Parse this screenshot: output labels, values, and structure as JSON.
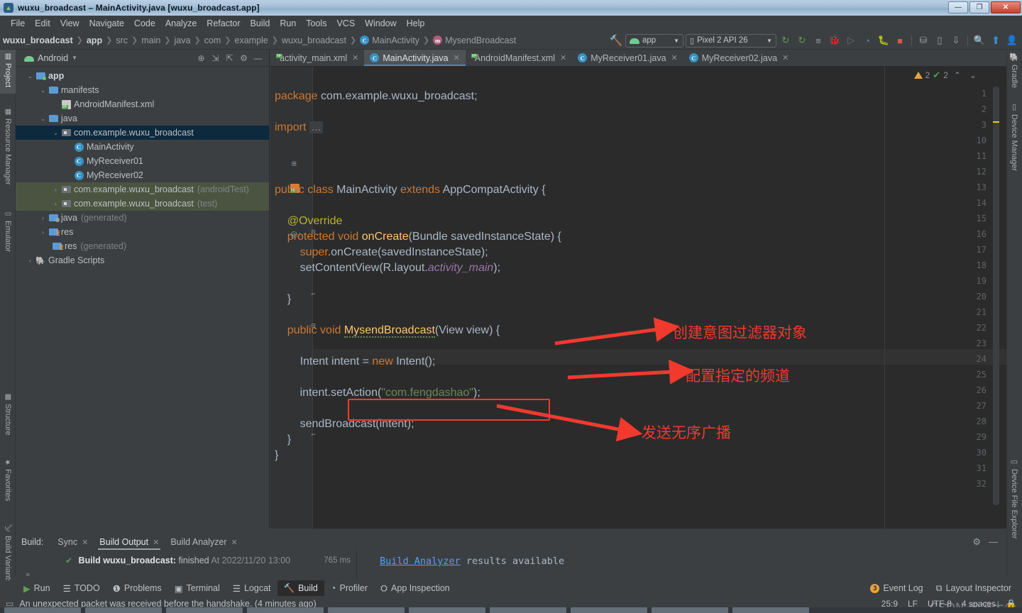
{
  "window": {
    "title": "wuxu_broadcast – MainActivity.java [wuxu_broadcast.app]",
    "minimize_label": "—",
    "maximize_label": "❐",
    "close_label": "✕"
  },
  "menubar": {
    "items": [
      "File",
      "Edit",
      "View",
      "Navigate",
      "Code",
      "Analyze",
      "Refactor",
      "Build",
      "Run",
      "Tools",
      "VCS",
      "Window",
      "Help"
    ]
  },
  "navbar": {
    "breadcrumbs": [
      {
        "label": "wuxu_broadcast",
        "bold": true,
        "icon": ""
      },
      {
        "label": "app",
        "bold": true,
        "icon": ""
      },
      {
        "label": "src",
        "bold": false,
        "icon": ""
      },
      {
        "label": "main",
        "bold": false,
        "icon": ""
      },
      {
        "label": "java",
        "bold": false,
        "icon": ""
      },
      {
        "label": "com",
        "bold": false,
        "icon": ""
      },
      {
        "label": "example",
        "bold": false,
        "icon": ""
      },
      {
        "label": "wuxu_broadcast",
        "bold": false,
        "icon": ""
      },
      {
        "label": "MainActivity",
        "bold": false,
        "icon": "class-icon"
      },
      {
        "label": "MysendBroadcast",
        "bold": false,
        "icon": "method-icon"
      }
    ],
    "run_config": "app",
    "device": "Pixel 2 API 26",
    "toolbar_icons": [
      "build-hammer-icon",
      "run-icon",
      "run-coverage-icon",
      "toggle-lines-icon",
      "debug-icon",
      "run-step-icon",
      "profiler-icon",
      "attach-debugger-icon",
      "stop-icon",
      "sdk-manager-icon",
      "avd-manager-icon",
      "sync-gradle-icon",
      "search-icon",
      "update-icon",
      "account-icon"
    ]
  },
  "left_tool_strip": {
    "tabs": [
      {
        "label": "Project",
        "icon": "project-icon",
        "selected": true
      },
      {
        "label": "Resource Manager",
        "icon": "resource-icon",
        "selected": false
      },
      {
        "label": "Emulator",
        "icon": "emulator-icon",
        "selected": false
      },
      {
        "label": "Structure",
        "icon": "structure-icon",
        "selected": false
      },
      {
        "label": "Favorites",
        "icon": "star-icon",
        "selected": false
      },
      {
        "label": "Build Variants",
        "icon": "variants-icon",
        "selected": false
      }
    ]
  },
  "right_tool_strip": {
    "tabs": [
      {
        "label": "Gradle",
        "icon": "gradle-elephant-icon"
      },
      {
        "label": "Device Manager",
        "icon": "device-manager-icon"
      },
      {
        "label": "Device File Explorer",
        "icon": "device-file-explorer-icon"
      }
    ]
  },
  "project_panel": {
    "title": "Android",
    "dropdown_arrow": "▾",
    "header_icons": [
      "locate-icon",
      "expand-all-icon",
      "collapse-all-icon",
      "settings-gear-icon",
      "hide-icon"
    ],
    "tree": [
      {
        "label": "app",
        "depth": 0,
        "twist": "⌄",
        "icon": "module-folder-icon",
        "style": "bold",
        "suffix": ""
      },
      {
        "label": "manifests",
        "depth": 1,
        "twist": "⌄",
        "icon": "folder-icon",
        "style": "",
        "suffix": ""
      },
      {
        "label": "AndroidManifest.xml",
        "depth": 2,
        "twist": "",
        "icon": "manifest-file-icon",
        "style": "",
        "suffix": ""
      },
      {
        "label": "java",
        "depth": 1,
        "twist": "⌄",
        "icon": "folder-icon",
        "style": "",
        "suffix": ""
      },
      {
        "label": "com.example.wuxu_broadcast",
        "depth": 2,
        "twist": "⌄",
        "icon": "package-icon",
        "style": "selected",
        "suffix": ""
      },
      {
        "label": "MainActivity",
        "depth": 3,
        "twist": "",
        "icon": "class-icon",
        "style": "",
        "suffix": ""
      },
      {
        "label": "MyReceiver01",
        "depth": 3,
        "twist": "",
        "icon": "class-icon",
        "style": "",
        "suffix": ""
      },
      {
        "label": "MyReceiver02",
        "depth": 3,
        "twist": "",
        "icon": "class-icon",
        "style": "",
        "suffix": ""
      },
      {
        "label": "com.example.wuxu_broadcast",
        "depth": 2,
        "twist": "›",
        "icon": "package-icon",
        "style": "green",
        "suffix": "(androidTest)"
      },
      {
        "label": "com.example.wuxu_broadcast",
        "depth": 2,
        "twist": "›",
        "icon": "package-icon",
        "style": "green",
        "suffix": "(test)"
      },
      {
        "label": "java",
        "depth": 1,
        "twist": "›",
        "icon": "generated-folder-icon",
        "style": "",
        "suffix": "(generated)"
      },
      {
        "label": "res",
        "depth": 1,
        "twist": "›",
        "icon": "res-folder-icon",
        "style": "",
        "suffix": ""
      },
      {
        "label": "res",
        "depth": 1,
        "twist": "",
        "icon": "res-folder-icon",
        "style": "",
        "suffix": "(generated)"
      },
      {
        "label": "Gradle Scripts",
        "depth": 0,
        "twist": "›",
        "icon": "gradle-elephant-icon",
        "style": "",
        "suffix": ""
      }
    ]
  },
  "editor": {
    "tabs": [
      {
        "label": "activity_main.xml",
        "icon": "layout-file-icon",
        "active": false,
        "close": "✕"
      },
      {
        "label": "MainActivity.java",
        "icon": "class-icon",
        "active": true,
        "close": "✕"
      },
      {
        "label": "AndroidManifest.xml",
        "icon": "manifest-file-icon",
        "active": false,
        "close": "✕"
      },
      {
        "label": "MyReceiver01.java",
        "icon": "class-icon",
        "active": false,
        "close": "✕"
      },
      {
        "label": "MyReceiver02.java",
        "icon": "class-icon",
        "active": false,
        "close": "✕"
      }
    ],
    "line_numbers": [
      "1",
      "2",
      "3",
      "10",
      "11",
      "12",
      "13",
      "14",
      "15",
      "16",
      "17",
      "18",
      "19",
      "20",
      "21",
      "22",
      "23",
      "24",
      "25",
      "26",
      "27",
      "28",
      "29",
      "30",
      "31",
      "32"
    ],
    "code_lines": [
      {
        "n": 1,
        "text": "package com.example.wuxu_broadcast;"
      },
      {
        "n": 2,
        "text": ""
      },
      {
        "n": 3,
        "text": "import ..."
      },
      {
        "n": 10,
        "text": ""
      },
      {
        "n": 11,
        "text": ""
      },
      {
        "n": 12,
        "text": ""
      },
      {
        "n": 13,
        "text": "public class MainActivity extends AppCompatActivity {"
      },
      {
        "n": 14,
        "text": ""
      },
      {
        "n": 15,
        "text": "    @Override"
      },
      {
        "n": 16,
        "text": "    protected void onCreate(Bundle savedInstanceState) {"
      },
      {
        "n": 17,
        "text": "        super.onCreate(savedInstanceState);"
      },
      {
        "n": 18,
        "text": "        setContentView(R.layout.activity_main);"
      },
      {
        "n": 19,
        "text": ""
      },
      {
        "n": 20,
        "text": "    }"
      },
      {
        "n": 21,
        "text": ""
      },
      {
        "n": 22,
        "text": "    public void MysendBroadcast(View view) {"
      },
      {
        "n": 23,
        "text": ""
      },
      {
        "n": 24,
        "text": "        Intent intent = new Intent();"
      },
      {
        "n": 25,
        "text": ""
      },
      {
        "n": 26,
        "text": "        intent.setAction(\"com.fengdashao\");"
      },
      {
        "n": 27,
        "text": ""
      },
      {
        "n": 28,
        "text": "        sendBroadcast(intent);"
      },
      {
        "n": 29,
        "text": "    }"
      },
      {
        "n": 30,
        "text": "}"
      },
      {
        "n": 31,
        "text": ""
      },
      {
        "n": 32,
        "text": ""
      }
    ],
    "inspection": {
      "warning_count": "2",
      "checked_count": "2",
      "up_arrow": "⌃",
      "down_arrow": "⌄"
    }
  },
  "annotations": {
    "callouts": [
      {
        "text": "创建意图过滤器对象",
        "target_line": 24
      },
      {
        "text": "配置指定的频道",
        "target_line": 26
      },
      {
        "text": "发送无序广播",
        "target_line": 28
      }
    ],
    "highlight_color": "#f2392e"
  },
  "build_panel": {
    "label": "Build:",
    "tabs": [
      {
        "label": "Sync",
        "close": "✕",
        "active": false
      },
      {
        "label": "Build Output",
        "close": "✕",
        "active": true
      },
      {
        "label": "Build Analyzer",
        "close": "✕",
        "active": false
      }
    ],
    "result_check": "✔",
    "result_bold": "Build wuxu_broadcast:",
    "result_text": " finished",
    "result_time": " At 2022/11/20 13:00",
    "duration": "765 ms",
    "analyzer_link": "Build Analyzer",
    "analyzer_rest": " results available",
    "gear_icon": "settings-gear-icon",
    "minimize_icon": "—",
    "expand_chevron": "»"
  },
  "bottom_tools": {
    "items": [
      {
        "label": "Run",
        "icon": "run-icon",
        "active": false
      },
      {
        "label": "TODO",
        "icon": "todo-icon",
        "active": false
      },
      {
        "label": "Problems",
        "icon": "problems-icon",
        "active": false
      },
      {
        "label": "Terminal",
        "icon": "terminal-icon",
        "active": false
      },
      {
        "label": "Logcat",
        "icon": "logcat-icon",
        "active": false
      },
      {
        "label": "Build",
        "icon": "build-hammer-icon",
        "active": true
      },
      {
        "label": "Profiler",
        "icon": "profiler-icon",
        "active": false
      },
      {
        "label": "App Inspection",
        "icon": "app-inspection-icon",
        "active": false
      }
    ],
    "event_log": {
      "label": "Event Log",
      "count": "3"
    },
    "layout_inspector": {
      "label": "Layout Inspector",
      "icon": "layout-inspector-icon"
    }
  },
  "status_bar": {
    "message": "An unexpected packet was received before the handshake. (4 minutes ago)",
    "message_icon": "notification-icon",
    "caret_position": "25:9",
    "line_separator": "LF",
    "encoding": "UTF-8",
    "indent": "4 spaces",
    "lock_icon": "lock-icon",
    "watermark": "CSDN @冯大少"
  },
  "colors": {
    "accent_blue": "#4a88c7",
    "annotation_red": "#f2392e",
    "editor_bg": "#2b2b2b",
    "panel_bg": "#3c3f41",
    "keyword_orange": "#cc7832",
    "string_green": "#6a8759",
    "method_yellow": "#ffc66d",
    "field_purple": "#9876aa",
    "selection_blue": "#0d293e",
    "test_green": "#4b5440"
  }
}
